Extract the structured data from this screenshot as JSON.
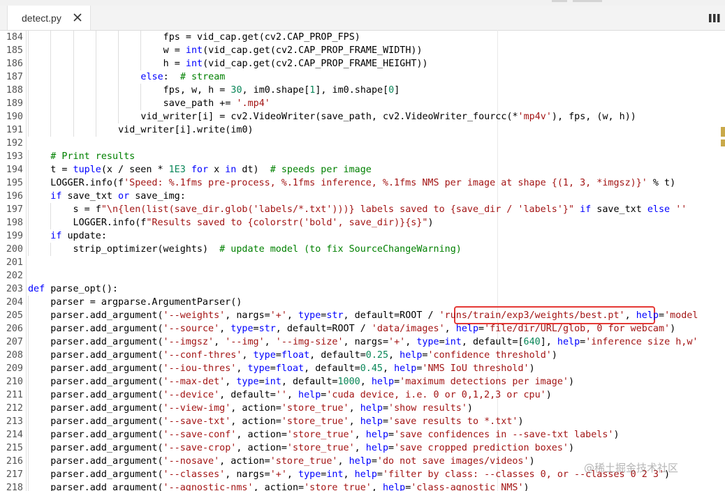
{
  "tab": {
    "label": "detect.py"
  },
  "watermark": "@稀土掘金技术社区",
  "colors": {
    "keyword": "#0000ff",
    "string": "#a31515",
    "number": "#098658",
    "comment": "#008000",
    "highlight": "#e53935"
  },
  "icons": {
    "tab_close": "close-icon",
    "split_editor": "split-editor-icon"
  },
  "lines": [
    {
      "n": "184",
      "indent": 6,
      "tokens": [
        [
          "t",
          "fps = vid_cap.get(cv2.CAP_PROP_FPS)"
        ]
      ]
    },
    {
      "n": "185",
      "indent": 6,
      "tokens": [
        [
          "t",
          "w = "
        ],
        [
          "k",
          "int"
        ],
        [
          "t",
          "(vid_cap.get(cv2.CAP_PROP_FRAME_WIDTH))"
        ]
      ]
    },
    {
      "n": "186",
      "indent": 6,
      "tokens": [
        [
          "t",
          "h = "
        ],
        [
          "k",
          "int"
        ],
        [
          "t",
          "(vid_cap.get(cv2.CAP_PROP_FRAME_HEIGHT))"
        ]
      ]
    },
    {
      "n": "187",
      "indent": 5,
      "tokens": [
        [
          "k",
          "else"
        ],
        [
          "t",
          ":  "
        ],
        [
          "c",
          "# stream"
        ]
      ]
    },
    {
      "n": "188",
      "indent": 6,
      "tokens": [
        [
          "t",
          "fps, w, h = "
        ],
        [
          "n",
          "30"
        ],
        [
          "t",
          ", im0.shape["
        ],
        [
          "n",
          "1"
        ],
        [
          "t",
          "], im0.shape["
        ],
        [
          "n",
          "0"
        ],
        [
          "t",
          "]"
        ]
      ]
    },
    {
      "n": "189",
      "indent": 6,
      "tokens": [
        [
          "t",
          "save_path += "
        ],
        [
          "s",
          "'.mp4'"
        ]
      ]
    },
    {
      "n": "190",
      "indent": 5,
      "tokens": [
        [
          "t",
          "vid_writer[i] = cv2.VideoWriter(save_path, cv2.VideoWriter_fourcc(*"
        ],
        [
          "s",
          "'mp4v'"
        ],
        [
          "t",
          "), fps, (w, h))"
        ]
      ]
    },
    {
      "n": "191",
      "indent": 4,
      "tokens": [
        [
          "t",
          "vid_writer[i].write(im0)"
        ]
      ]
    },
    {
      "n": "192",
      "indent": 0,
      "tokens": []
    },
    {
      "n": "193",
      "indent": 1,
      "tokens": [
        [
          "c",
          "# Print results"
        ]
      ]
    },
    {
      "n": "194",
      "indent": 1,
      "tokens": [
        [
          "t",
          "t = "
        ],
        [
          "k",
          "tuple"
        ],
        [
          "t",
          "(x / seen * "
        ],
        [
          "n",
          "1E3"
        ],
        [
          "t",
          " "
        ],
        [
          "k",
          "for"
        ],
        [
          "t",
          " x "
        ],
        [
          "k",
          "in"
        ],
        [
          "t",
          " dt)  "
        ],
        [
          "c",
          "# speeds per image"
        ]
      ]
    },
    {
      "n": "195",
      "indent": 1,
      "tokens": [
        [
          "t",
          "LOGGER.info(f"
        ],
        [
          "s",
          "'Speed: %.1fms pre-process, %.1fms inference, %.1fms NMS per image at shape {(1, 3, *imgsz)}'"
        ],
        [
          "t",
          " % t)"
        ]
      ]
    },
    {
      "n": "196",
      "indent": 1,
      "tokens": [
        [
          "k",
          "if"
        ],
        [
          "t",
          " save_txt "
        ],
        [
          "k",
          "or"
        ],
        [
          "t",
          " save_img:"
        ]
      ]
    },
    {
      "n": "197",
      "indent": 2,
      "tokens": [
        [
          "t",
          "s = f"
        ],
        [
          "s",
          "\"\\n{len(list(save_dir.glob('labels/*.txt')))} labels saved to {save_dir / 'labels'}\""
        ],
        [
          "t",
          " "
        ],
        [
          "k",
          "if"
        ],
        [
          "t",
          " save_txt "
        ],
        [
          "k",
          "else"
        ],
        [
          "t",
          " "
        ],
        [
          "s",
          "''"
        ]
      ]
    },
    {
      "n": "198",
      "indent": 2,
      "tokens": [
        [
          "t",
          "LOGGER.info(f"
        ],
        [
          "s",
          "\"Results saved to {colorstr('bold', save_dir)}{s}\""
        ],
        [
          "t",
          ")"
        ]
      ]
    },
    {
      "n": "199",
      "indent": 1,
      "tokens": [
        [
          "k",
          "if"
        ],
        [
          "t",
          " update:"
        ]
      ]
    },
    {
      "n": "200",
      "indent": 2,
      "tokens": [
        [
          "t",
          "strip_optimizer(weights)  "
        ],
        [
          "c",
          "# update model (to fix SourceChangeWarning)"
        ]
      ]
    },
    {
      "n": "201",
      "indent": 0,
      "tokens": []
    },
    {
      "n": "202",
      "indent": 0,
      "tokens": []
    },
    {
      "n": "203",
      "indent": 0,
      "tokens": [
        [
          "k",
          "def"
        ],
        [
          "t",
          " parse_opt():"
        ]
      ]
    },
    {
      "n": "204",
      "indent": 1,
      "tokens": [
        [
          "t",
          "parser = argparse.ArgumentParser()"
        ]
      ]
    },
    {
      "n": "205",
      "indent": 1,
      "tokens": [
        [
          "t",
          "parser.add_argument("
        ],
        [
          "s",
          "'--weights'"
        ],
        [
          "t",
          ", nargs="
        ],
        [
          "s",
          "'+'"
        ],
        [
          "t",
          ", "
        ],
        [
          "k",
          "type"
        ],
        [
          "t",
          "="
        ],
        [
          "k",
          "str"
        ],
        [
          "t",
          ", default=ROOT / "
        ],
        [
          "s",
          "'runs/train/exp3/weights/best.pt'"
        ],
        [
          "t",
          ", "
        ],
        [
          "k",
          "help"
        ],
        [
          "t",
          "="
        ],
        [
          "s",
          "'model"
        ]
      ]
    },
    {
      "n": "206",
      "indent": 1,
      "tokens": [
        [
          "t",
          "parser.add_argument("
        ],
        [
          "s",
          "'--source'"
        ],
        [
          "t",
          ", "
        ],
        [
          "k",
          "type"
        ],
        [
          "t",
          "="
        ],
        [
          "k",
          "str"
        ],
        [
          "t",
          ", default=ROOT / "
        ],
        [
          "s",
          "'data/images'"
        ],
        [
          "t",
          ", "
        ],
        [
          "k",
          "help"
        ],
        [
          "t",
          "="
        ],
        [
          "s",
          "'file/dir/URL/glob, 0 for webcam'"
        ],
        [
          "t",
          ")"
        ]
      ]
    },
    {
      "n": "207",
      "indent": 1,
      "tokens": [
        [
          "t",
          "parser.add_argument("
        ],
        [
          "s",
          "'--imgsz'"
        ],
        [
          "t",
          ", "
        ],
        [
          "s",
          "'--img'"
        ],
        [
          "t",
          ", "
        ],
        [
          "s",
          "'--img-size'"
        ],
        [
          "t",
          ", nargs="
        ],
        [
          "s",
          "'+'"
        ],
        [
          "t",
          ", "
        ],
        [
          "k",
          "type"
        ],
        [
          "t",
          "="
        ],
        [
          "k",
          "int"
        ],
        [
          "t",
          ", default=["
        ],
        [
          "n",
          "640"
        ],
        [
          "t",
          "], "
        ],
        [
          "k",
          "help"
        ],
        [
          "t",
          "="
        ],
        [
          "s",
          "'inference size h,w'"
        ]
      ]
    },
    {
      "n": "208",
      "indent": 1,
      "tokens": [
        [
          "t",
          "parser.add_argument("
        ],
        [
          "s",
          "'--conf-thres'"
        ],
        [
          "t",
          ", "
        ],
        [
          "k",
          "type"
        ],
        [
          "t",
          "="
        ],
        [
          "k",
          "float"
        ],
        [
          "t",
          ", default="
        ],
        [
          "n",
          "0.25"
        ],
        [
          "t",
          ", "
        ],
        [
          "k",
          "help"
        ],
        [
          "t",
          "="
        ],
        [
          "s",
          "'confidence threshold'"
        ],
        [
          "t",
          ")"
        ]
      ]
    },
    {
      "n": "209",
      "indent": 1,
      "tokens": [
        [
          "t",
          "parser.add_argument("
        ],
        [
          "s",
          "'--iou-thres'"
        ],
        [
          "t",
          ", "
        ],
        [
          "k",
          "type"
        ],
        [
          "t",
          "="
        ],
        [
          "k",
          "float"
        ],
        [
          "t",
          ", default="
        ],
        [
          "n",
          "0.45"
        ],
        [
          "t",
          ", "
        ],
        [
          "k",
          "help"
        ],
        [
          "t",
          "="
        ],
        [
          "s",
          "'NMS IoU threshold'"
        ],
        [
          "t",
          ")"
        ]
      ]
    },
    {
      "n": "210",
      "indent": 1,
      "tokens": [
        [
          "t",
          "parser.add_argument("
        ],
        [
          "s",
          "'--max-det'"
        ],
        [
          "t",
          ", "
        ],
        [
          "k",
          "type"
        ],
        [
          "t",
          "="
        ],
        [
          "k",
          "int"
        ],
        [
          "t",
          ", default="
        ],
        [
          "n",
          "1000"
        ],
        [
          "t",
          ", "
        ],
        [
          "k",
          "help"
        ],
        [
          "t",
          "="
        ],
        [
          "s",
          "'maximum detections per image'"
        ],
        [
          "t",
          ")"
        ]
      ]
    },
    {
      "n": "211",
      "indent": 1,
      "tokens": [
        [
          "t",
          "parser.add_argument("
        ],
        [
          "s",
          "'--device'"
        ],
        [
          "t",
          ", default="
        ],
        [
          "s",
          "''"
        ],
        [
          "t",
          ", "
        ],
        [
          "k",
          "help"
        ],
        [
          "t",
          "="
        ],
        [
          "s",
          "'cuda device, i.e. 0 or 0,1,2,3 or cpu'"
        ],
        [
          "t",
          ")"
        ]
      ]
    },
    {
      "n": "212",
      "indent": 1,
      "tokens": [
        [
          "t",
          "parser.add_argument("
        ],
        [
          "s",
          "'--view-img'"
        ],
        [
          "t",
          ", action="
        ],
        [
          "s",
          "'store_true'"
        ],
        [
          "t",
          ", "
        ],
        [
          "k",
          "help"
        ],
        [
          "t",
          "="
        ],
        [
          "s",
          "'show results'"
        ],
        [
          "t",
          ")"
        ]
      ]
    },
    {
      "n": "213",
      "indent": 1,
      "tokens": [
        [
          "t",
          "parser.add_argument("
        ],
        [
          "s",
          "'--save-txt'"
        ],
        [
          "t",
          ", action="
        ],
        [
          "s",
          "'store_true'"
        ],
        [
          "t",
          ", "
        ],
        [
          "k",
          "help"
        ],
        [
          "t",
          "="
        ],
        [
          "s",
          "'save results to *.txt'"
        ],
        [
          "t",
          ")"
        ]
      ]
    },
    {
      "n": "214",
      "indent": 1,
      "tokens": [
        [
          "t",
          "parser.add_argument("
        ],
        [
          "s",
          "'--save-conf'"
        ],
        [
          "t",
          ", action="
        ],
        [
          "s",
          "'store_true'"
        ],
        [
          "t",
          ", "
        ],
        [
          "k",
          "help"
        ],
        [
          "t",
          "="
        ],
        [
          "s",
          "'save confidences in --save-txt labels'"
        ],
        [
          "t",
          ")"
        ]
      ]
    },
    {
      "n": "215",
      "indent": 1,
      "tokens": [
        [
          "t",
          "parser.add_argument("
        ],
        [
          "s",
          "'--save-crop'"
        ],
        [
          "t",
          ", action="
        ],
        [
          "s",
          "'store_true'"
        ],
        [
          "t",
          ", "
        ],
        [
          "k",
          "help"
        ],
        [
          "t",
          "="
        ],
        [
          "s",
          "'save cropped prediction boxes'"
        ],
        [
          "t",
          ")"
        ]
      ]
    },
    {
      "n": "216",
      "indent": 1,
      "tokens": [
        [
          "t",
          "parser.add_argument("
        ],
        [
          "s",
          "'--nosave'"
        ],
        [
          "t",
          ", action="
        ],
        [
          "s",
          "'store_true'"
        ],
        [
          "t",
          ", "
        ],
        [
          "k",
          "help"
        ],
        [
          "t",
          "="
        ],
        [
          "s",
          "'do not save images/videos'"
        ],
        [
          "t",
          ")"
        ]
      ]
    },
    {
      "n": "217",
      "indent": 1,
      "tokens": [
        [
          "t",
          "parser.add_argument("
        ],
        [
          "s",
          "'--classes'"
        ],
        [
          "t",
          ", nargs="
        ],
        [
          "s",
          "'+'"
        ],
        [
          "t",
          ", "
        ],
        [
          "k",
          "type"
        ],
        [
          "t",
          "="
        ],
        [
          "k",
          "int"
        ],
        [
          "t",
          ", "
        ],
        [
          "k",
          "help"
        ],
        [
          "t",
          "="
        ],
        [
          "s",
          "'filter by class: --classes 0, or --classes 0 2 3'"
        ],
        [
          "t",
          ")"
        ]
      ]
    },
    {
      "n": "218",
      "indent": 1,
      "tokens": [
        [
          "t",
          "parser.add_argument("
        ],
        [
          "s",
          "'--agnostic-nms'"
        ],
        [
          "t",
          ", action="
        ],
        [
          "s",
          "'store_true'"
        ],
        [
          "t",
          ", "
        ],
        [
          "k",
          "help"
        ],
        [
          "t",
          "="
        ],
        [
          "s",
          "'class-agnostic NMS'"
        ],
        [
          "t",
          ")"
        ]
      ]
    }
  ]
}
